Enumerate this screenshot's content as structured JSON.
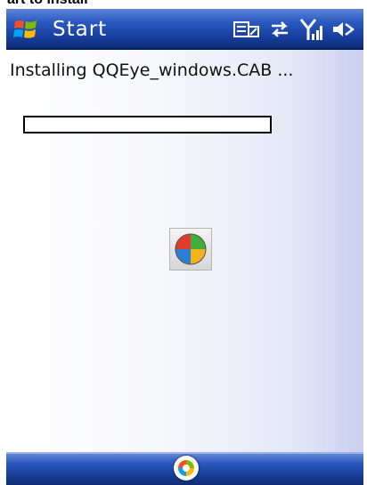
{
  "top_caption": "art to install",
  "titlebar": {
    "start_label": "Start",
    "icons": [
      "data-connection-icon",
      "sync-arrows-icon",
      "signal-strength-icon",
      "speaker-icon"
    ]
  },
  "install": {
    "message": "Installing QQEye_windows.CAB ...",
    "progress_fraction": 0
  },
  "app_icon": "installer-pie-icon",
  "bottombar": {
    "center_icon": "windows-logo-icon"
  },
  "colors": {
    "title_bar": "#173e9c",
    "progress_fill": "#1f4fb8"
  }
}
